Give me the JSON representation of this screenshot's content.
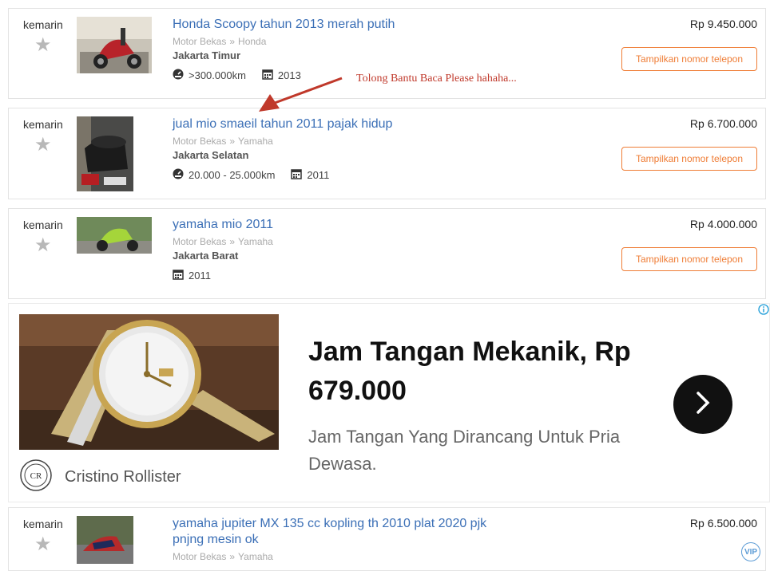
{
  "listings": [
    {
      "date": "kemarin",
      "title": "Honda Scoopy tahun 2013 merah putih",
      "category": "Motor Bekas",
      "brand": "Honda",
      "city": "Jakarta Timur",
      "mileage": ">300.000km",
      "year": "2013",
      "price": "Rp 9.450.000",
      "button": "Tampilkan nomor telepon"
    },
    {
      "date": "kemarin",
      "title": "jual mio smaeil tahun 2011 pajak hidup",
      "category": "Motor Bekas",
      "brand": "Yamaha",
      "city": "Jakarta Selatan",
      "mileage": "20.000 - 25.000km",
      "year": "2011",
      "price": "Rp 6.700.000",
      "button": "Tampilkan nomor telepon"
    },
    {
      "date": "kemarin",
      "title": "yamaha mio 2011",
      "category": "Motor Bekas",
      "brand": "Yamaha",
      "city": "Jakarta Barat",
      "year": "2011",
      "price": "Rp 4.000.000",
      "button": "Tampilkan nomor telepon"
    },
    {
      "date": "kemarin",
      "title": "yamaha jupiter MX 135 cc kopling th 2010 plat 2020 pjk pnjng mesin ok",
      "category": "Motor Bekas",
      "brand": "Yamaha",
      "price": "Rp 6.500.000"
    }
  ],
  "breadcrumb_sep": "»",
  "annotation": "Tolong Bantu Baca Please hahaha...",
  "ad": {
    "headline": "Jam Tangan Mekanik, Rp 679.000",
    "description": "Jam Tangan Yang Dirancang Untuk Pria Dewasa.",
    "brand": "Cristino Rollister",
    "logo_text": "CR"
  },
  "vip_badge": "VIP",
  "colors": {
    "link": "#3b6fb6",
    "button_accent": "#ef7d36",
    "annotation": "#c0392b"
  }
}
